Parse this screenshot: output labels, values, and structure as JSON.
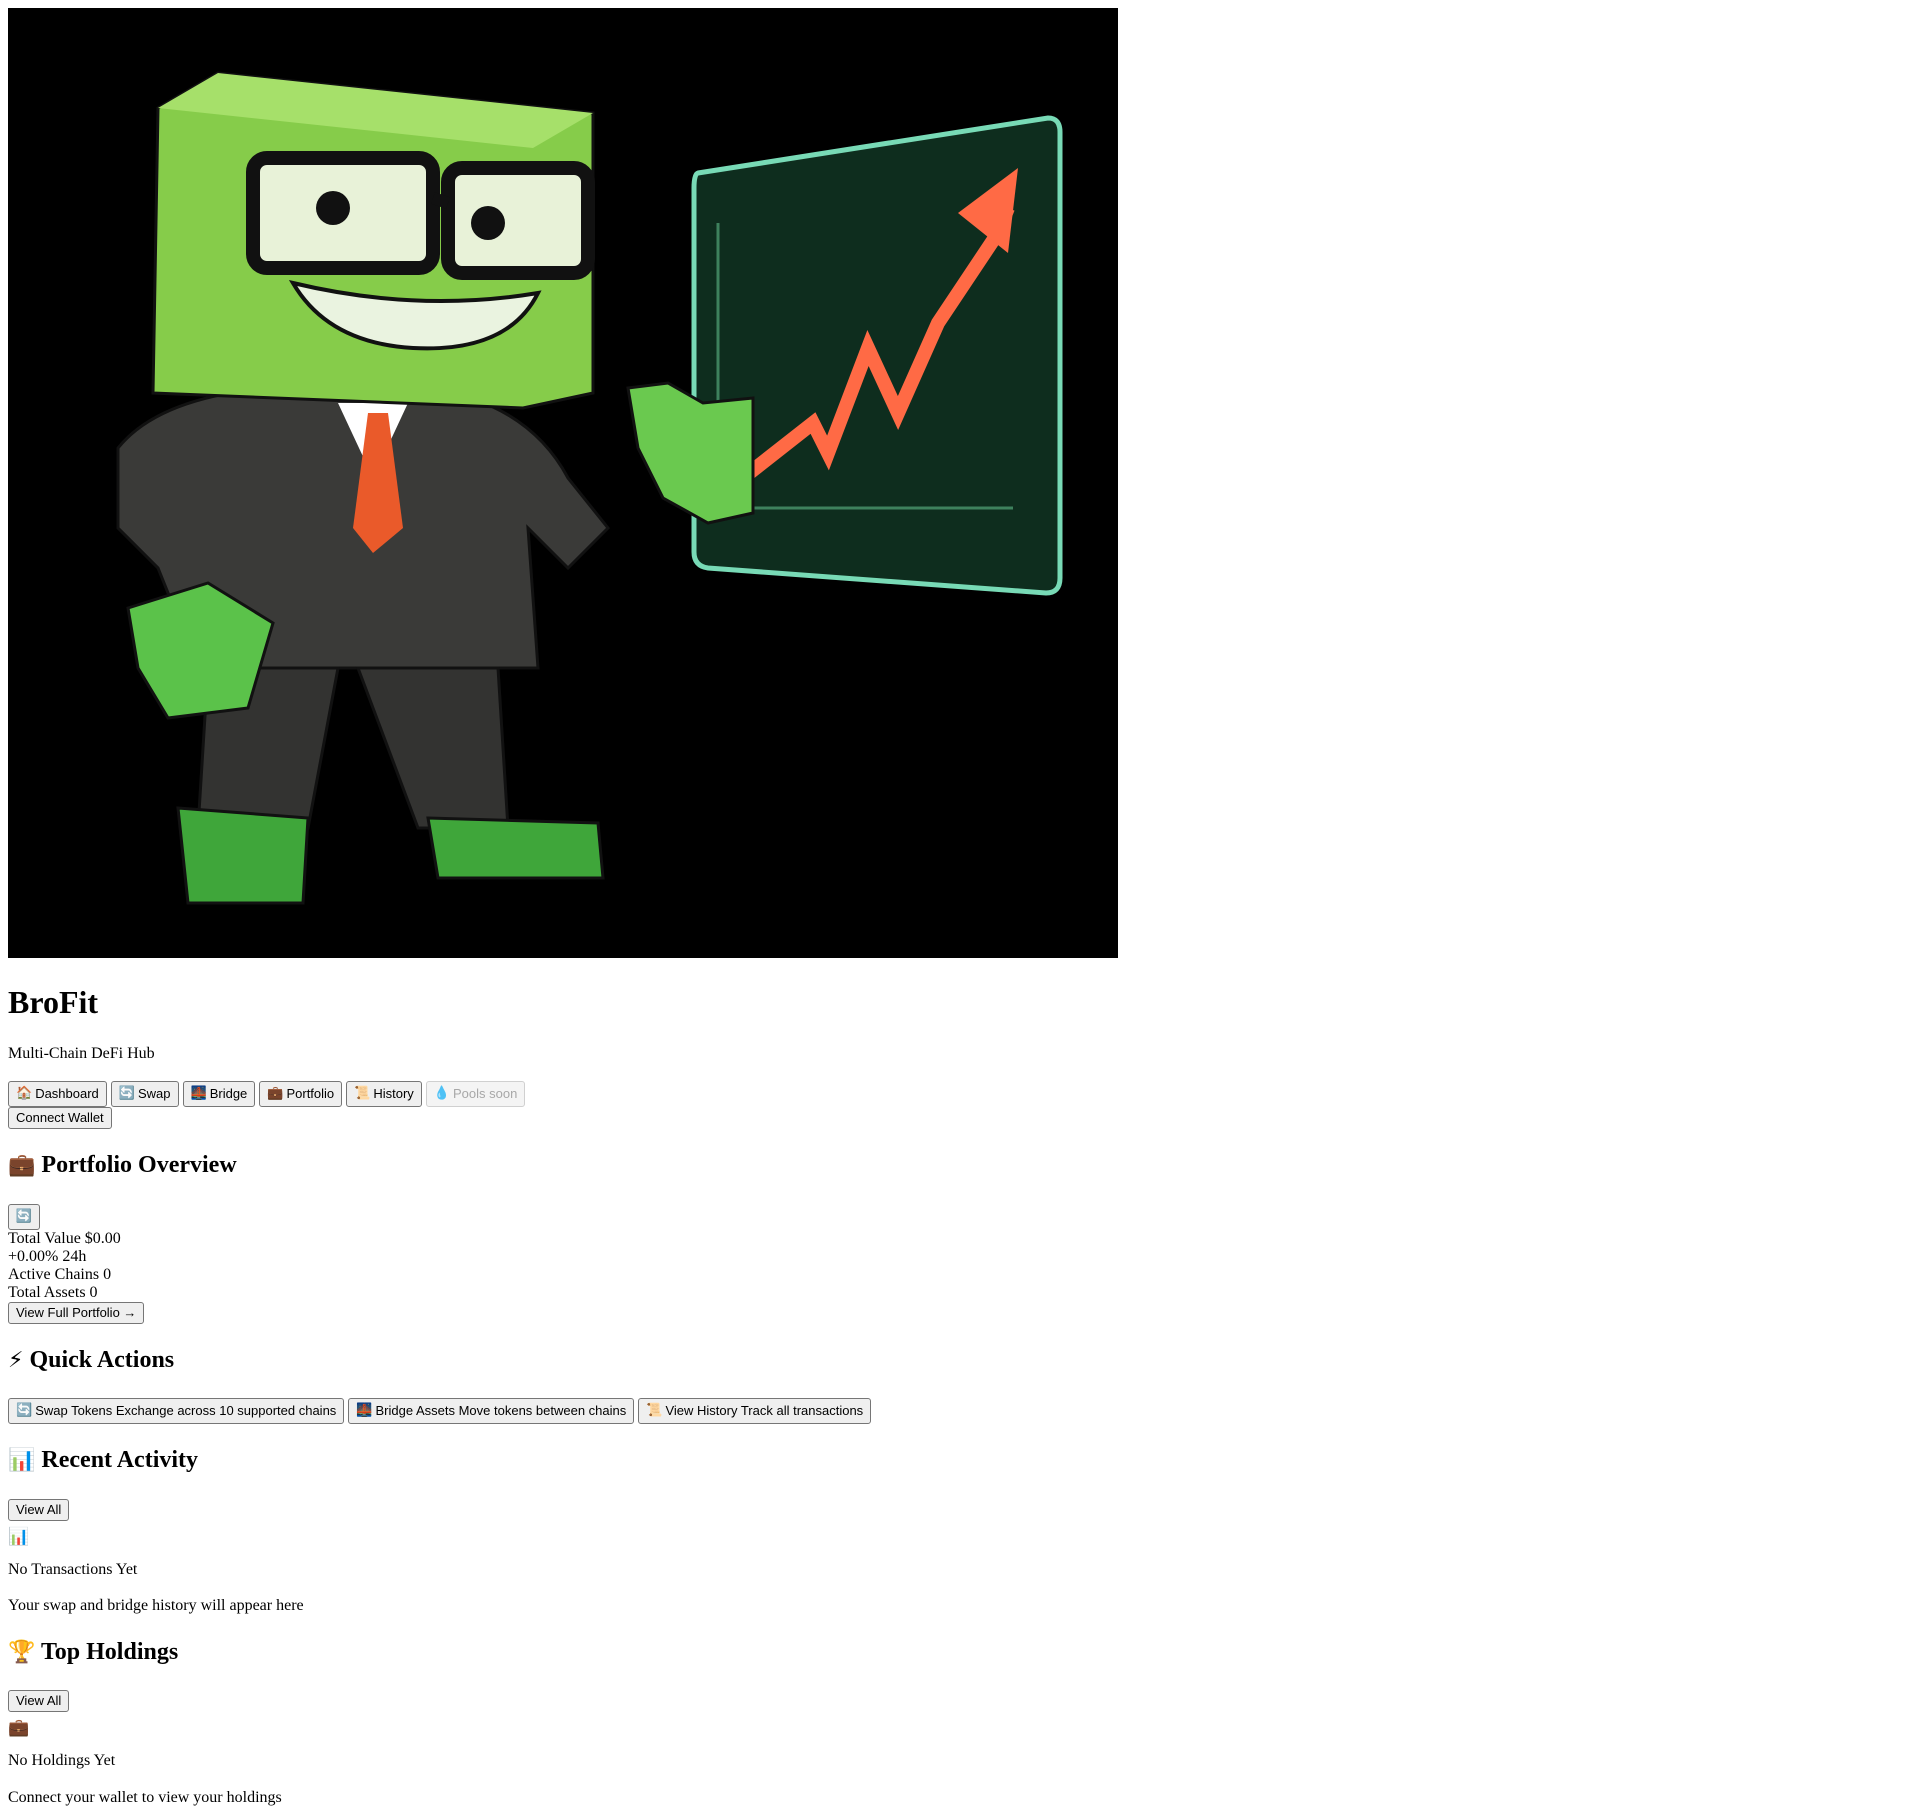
{
  "hero": {
    "image": "brofit-mascot-illustration"
  },
  "app": {
    "title": "BroFit",
    "tagline": "Multi-Chain DeFi Hub"
  },
  "nav": {
    "items": [
      {
        "icon": "🏠",
        "label": "Dashboard",
        "disabled": false
      },
      {
        "icon": "🔄",
        "label": "Swap",
        "disabled": false
      },
      {
        "icon": "🌉",
        "label": "Bridge",
        "disabled": false
      },
      {
        "icon": "💼",
        "label": "Portfolio",
        "disabled": false
      },
      {
        "icon": "📜",
        "label": "History",
        "disabled": false
      },
      {
        "icon": "💧",
        "label": "Pools soon",
        "disabled": true
      }
    ],
    "connect_wallet": "Connect Wallet"
  },
  "portfolio": {
    "icon": "💼",
    "heading": "Portfolio Overview",
    "refresh_icon": "🔄",
    "total_value": "Total Value $0.00",
    "change": "+0.00% 24h",
    "active_chains": "Active Chains 0",
    "total_assets": "Total Assets 0",
    "view_full": "View Full Portfolio →"
  },
  "quick_actions": {
    "icon": "⚡",
    "heading": "Quick Actions",
    "items": [
      {
        "icon": "🔄",
        "label": "Swap Tokens Exchange across 10 supported chains"
      },
      {
        "icon": "🌉",
        "label": "Bridge Assets Move tokens between chains"
      },
      {
        "icon": "📜",
        "label": "View History Track all transactions"
      }
    ]
  },
  "recent_activity": {
    "icon": "📊",
    "heading": "Recent Activity",
    "view_all": "View All",
    "empty_icon": "📊",
    "empty_title": "No Transactions Yet",
    "empty_text": "Your swap and bridge history will appear here"
  },
  "top_holdings": {
    "icon": "🏆",
    "heading": "Top Holdings",
    "view_all": "View All",
    "empty_icon": "💼",
    "empty_title": "No Holdings Yet",
    "empty_text": "Connect your wallet to view your holdings"
  }
}
